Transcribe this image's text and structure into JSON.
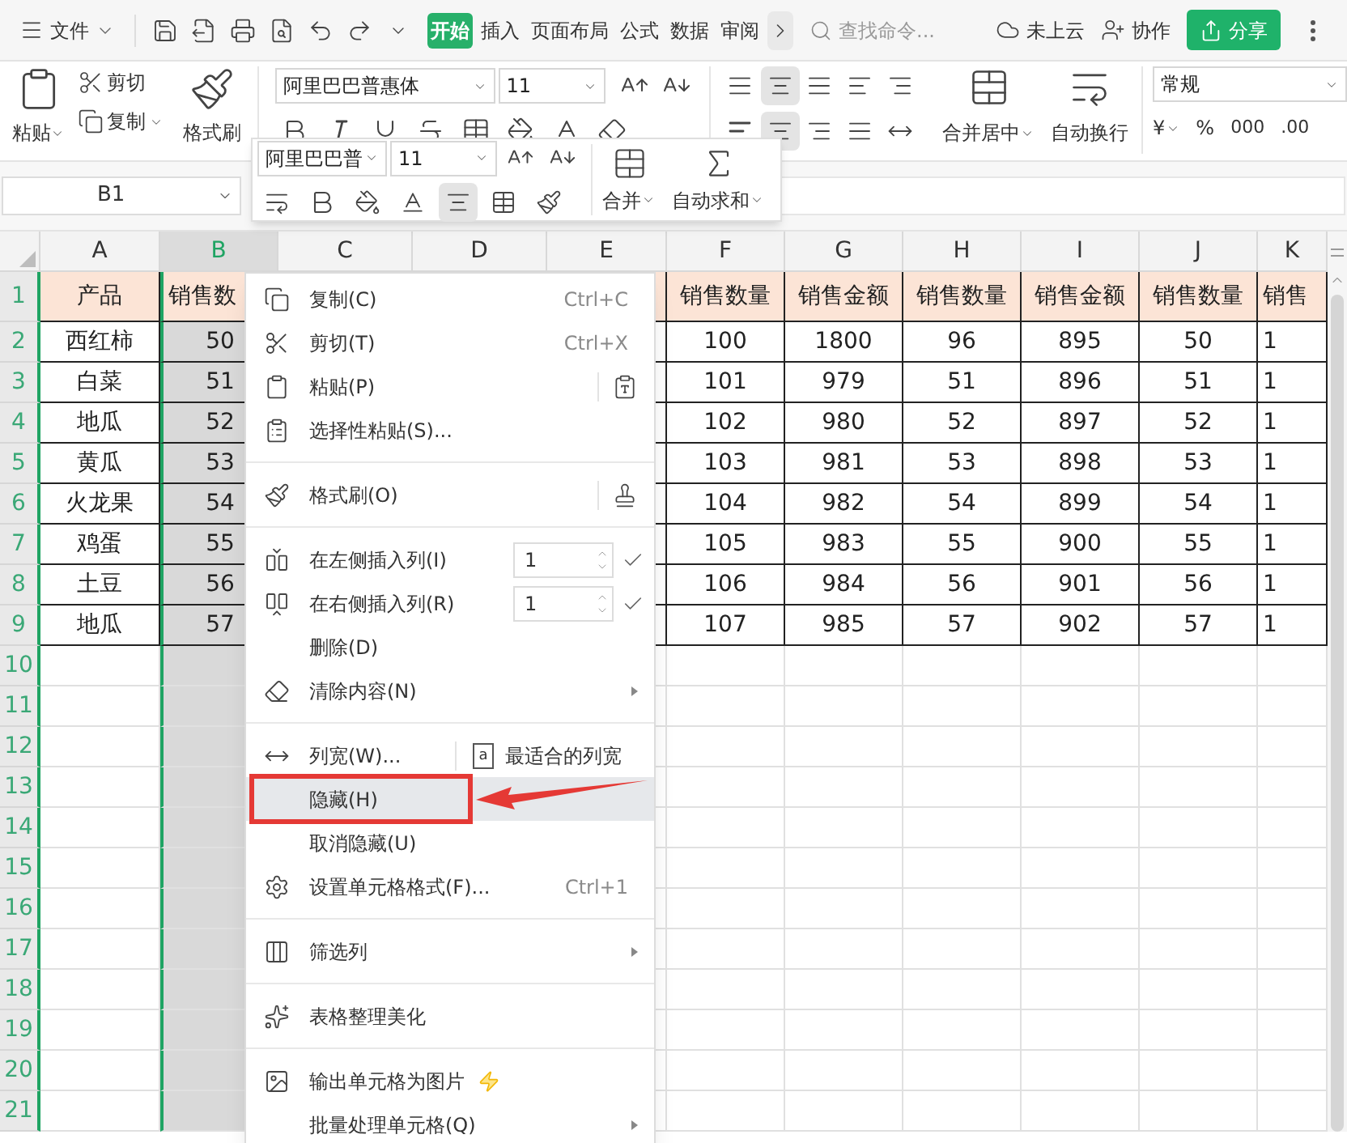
{
  "titlebar": {
    "file_menu": "文件",
    "tabs": [
      {
        "label": "开始",
        "selected": true
      },
      {
        "label": "插入",
        "selected": false
      },
      {
        "label": "页面布局",
        "selected": false
      },
      {
        "label": "公式",
        "selected": false
      },
      {
        "label": "数据",
        "selected": false
      },
      {
        "label": "审阅",
        "selected": false
      }
    ],
    "search": {
      "placeholder": "查找命令..."
    },
    "cloud": "未上云",
    "collab": "协作",
    "share": "分享"
  },
  "ribbon": {
    "paste": "粘贴",
    "cut": "剪切",
    "copy": "复制",
    "format_painter": "格式刷",
    "font": "阿里巴巴普惠体",
    "font_size": "11",
    "merge": "合并居中",
    "wrap": "自动换行",
    "number_format": "常规",
    "currency": "¥",
    "percent": "%",
    "thousands": "000",
    "decimal": ".00"
  },
  "name_box": "B1",
  "mini_toolbar": {
    "font": "阿里巴巴普",
    "font_size": "11",
    "merge": "合并",
    "autosum": "自动求和"
  },
  "sheet": {
    "columns": [
      {
        "label": "A",
        "selected": false
      },
      {
        "label": "B",
        "selected": true
      },
      {
        "label": "C",
        "selected": false
      },
      {
        "label": "D",
        "selected": false
      },
      {
        "label": "E",
        "selected": false
      },
      {
        "label": "F",
        "selected": false
      },
      {
        "label": "G",
        "selected": false
      },
      {
        "label": "H",
        "selected": false
      },
      {
        "label": "I",
        "selected": false
      },
      {
        "label": "J",
        "selected": false
      },
      {
        "label": "K",
        "selected": false
      }
    ],
    "row_numbers": [
      "1",
      "2",
      "3",
      "4",
      "5",
      "6",
      "7",
      "8",
      "9",
      "10",
      "11",
      "12",
      "13",
      "14",
      "15",
      "16",
      "17",
      "18",
      "19",
      "20",
      "21"
    ],
    "rows": [
      {
        "kind": "header",
        "cells": [
          "产品",
          "销售数",
          "",
          "",
          "",
          "销售数量",
          "销售金额",
          "销售数量",
          "销售金额",
          "销售数量",
          "销售"
        ]
      },
      {
        "kind": "data",
        "cells": [
          "西红柿",
          "50",
          "",
          "",
          "",
          "100",
          "1800",
          "96",
          "895",
          "50",
          "1"
        ]
      },
      {
        "kind": "data",
        "cells": [
          "白菜",
          "51",
          "",
          "",
          "",
          "101",
          "979",
          "51",
          "896",
          "51",
          "1"
        ]
      },
      {
        "kind": "data",
        "cells": [
          "地瓜",
          "52",
          "",
          "",
          "",
          "102",
          "980",
          "52",
          "897",
          "52",
          "1"
        ]
      },
      {
        "kind": "data",
        "cells": [
          "黄瓜",
          "53",
          "",
          "",
          "",
          "103",
          "981",
          "53",
          "898",
          "53",
          "1"
        ]
      },
      {
        "kind": "data",
        "cells": [
          "火龙果",
          "54",
          "",
          "",
          "",
          "104",
          "982",
          "54",
          "899",
          "54",
          "1"
        ]
      },
      {
        "kind": "data",
        "cells": [
          "鸡蛋",
          "55",
          "",
          "",
          "",
          "105",
          "983",
          "55",
          "900",
          "55",
          "1"
        ]
      },
      {
        "kind": "data",
        "cells": [
          "土豆",
          "56",
          "",
          "",
          "",
          "106",
          "984",
          "56",
          "901",
          "56",
          "1"
        ]
      },
      {
        "kind": "data",
        "cells": [
          "地瓜",
          "57",
          "",
          "",
          "",
          "107",
          "985",
          "57",
          "902",
          "57",
          "1"
        ]
      }
    ]
  },
  "context_menu": {
    "items": [
      {
        "kind": "item",
        "label": "复制(C)",
        "shortcut": "Ctrl+C",
        "selected": false,
        "submenu": false,
        "premium": false
      },
      {
        "kind": "item",
        "label": "剪切(T)",
        "shortcut": "Ctrl+X",
        "selected": false,
        "submenu": false,
        "premium": false
      },
      {
        "kind": "item",
        "label": "粘贴(P)",
        "selected": false,
        "submenu": false,
        "premium": false
      },
      {
        "kind": "item",
        "label": "选择性粘贴(S)...",
        "selected": false,
        "submenu": false,
        "premium": false
      },
      {
        "kind": "separator"
      },
      {
        "kind": "item",
        "label": "格式刷(O)",
        "selected": false,
        "submenu": false,
        "premium": false
      },
      {
        "kind": "separator"
      },
      {
        "kind": "spinner",
        "label": "在左侧插入列(I)",
        "value": "1",
        "selected": false
      },
      {
        "kind": "spinner",
        "label": "在右侧插入列(R)",
        "value": "1",
        "selected": false
      },
      {
        "kind": "item",
        "label": "删除(D)",
        "selected": false,
        "submenu": false,
        "premium": false
      },
      {
        "kind": "item",
        "label": "清除内容(N)",
        "selected": false,
        "submenu": true,
        "premium": false
      },
      {
        "kind": "separator"
      },
      {
        "kind": "split",
        "label": "列宽(W)...",
        "second": "最适合的列宽",
        "letter": "a",
        "selected": false
      },
      {
        "kind": "item",
        "label": "隐藏(H)",
        "selected": true,
        "submenu": false,
        "premium": false
      },
      {
        "kind": "item",
        "label": "取消隐藏(U)",
        "selected": false,
        "submenu": false,
        "premium": false
      },
      {
        "kind": "item",
        "label": "设置单元格格式(F)...",
        "shortcut": "Ctrl+1",
        "selected": false,
        "submenu": false,
        "premium": false
      },
      {
        "kind": "separator"
      },
      {
        "kind": "item",
        "label": "筛选列",
        "selected": false,
        "submenu": true,
        "premium": false
      },
      {
        "kind": "separator"
      },
      {
        "kind": "item",
        "label": "表格整理美化",
        "selected": false,
        "submenu": false,
        "premium": false
      },
      {
        "kind": "separator"
      },
      {
        "kind": "item",
        "label": "输出单元格为图片",
        "selected": false,
        "submenu": false,
        "premium": true
      },
      {
        "kind": "item",
        "label": "批量处理单元格(Q)",
        "selected": false,
        "submenu": true,
        "premium": false
      }
    ]
  }
}
